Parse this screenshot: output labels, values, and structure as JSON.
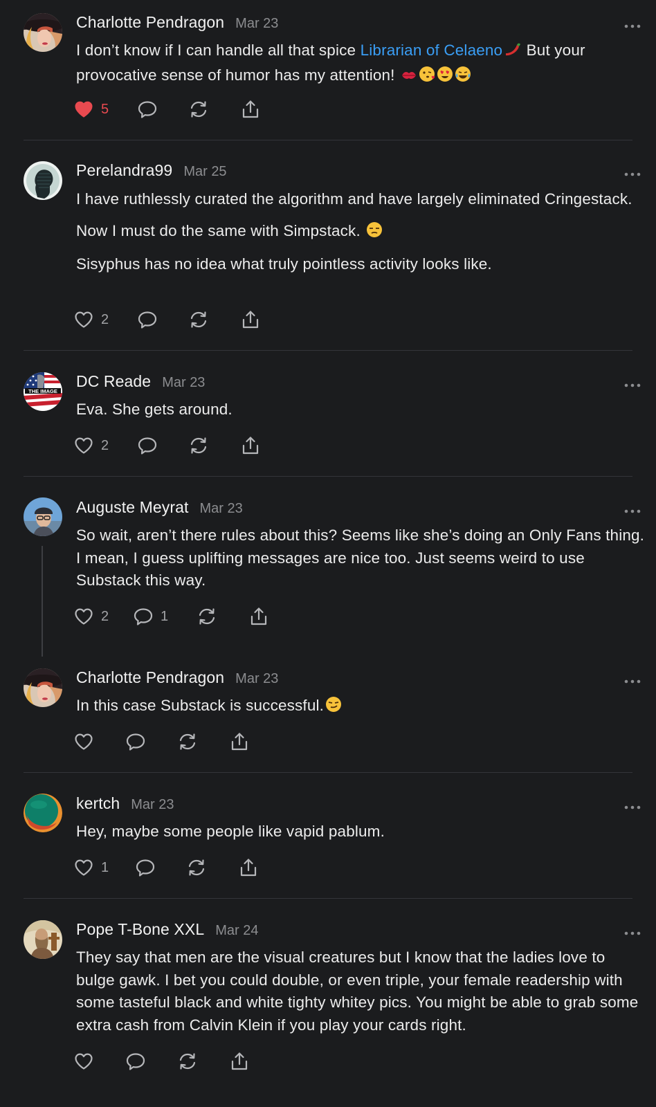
{
  "colors": {
    "background": "#1b1c1e",
    "link": "#3a9ef5",
    "liked_heart": "#e94a50",
    "muted": "#8c8d90"
  },
  "comments": [
    {
      "author": "Charlotte Pendragon",
      "date": "Mar 23",
      "text_before": "I don’t know if I can handle all that spice ",
      "mention": "Librarian of Celaeno",
      "text_after": " But your provocative sense of humor has my attention!",
      "emoji_icons": [
        "hot-pepper-icon",
        "kiss-mark-icon",
        "face-blowing-kiss-icon",
        "heart-eyes-icon",
        "tears-of-joy-icon"
      ],
      "likes": "5",
      "liked": true,
      "avatar_icon": "avatar-woman-hat-icon"
    },
    {
      "author": "Perelandra99",
      "date": "Mar 25",
      "paragraphs": [
        "I have ruthlessly curated the algorithm and have largely eliminated Cringestack.",
        "Now I must do the same with Simpstack.",
        "Sisyphus has no idea what truly pointless activity looks like."
      ],
      "emoji_icons": [
        "unamused-face-icon"
      ],
      "likes": "2",
      "avatar_icon": "avatar-silhouette-head-icon"
    },
    {
      "author": "DC Reade",
      "date": "Mar 23",
      "text": "Eva. She gets around.",
      "likes": "2",
      "avatar_icon": "avatar-the-image-flag-icon",
      "avatar_text": "THE IMAGE"
    },
    {
      "author": "Auguste Meyrat",
      "date": "Mar 23",
      "text": "So wait, aren’t there rules about this? Seems like she’s doing an Only Fans thing. I mean, I guess uplifting messages are nice too. Just seems weird to use Substack this way.",
      "likes": "2",
      "replies": "1",
      "avatar_icon": "avatar-man-glasses-cap-icon"
    },
    {
      "author": "Charlotte Pendragon",
      "date": "Mar 23",
      "text": "In this case Substack is successful.",
      "emoji_icons": [
        "smirking-face-icon"
      ],
      "avatar_icon": "avatar-woman-hat-icon"
    },
    {
      "author": "kertch",
      "date": "Mar 23",
      "text": "Hey, maybe some people like vapid pablum.",
      "likes": "1",
      "avatar_icon": "avatar-green-orange-circle-icon"
    },
    {
      "author": "Pope T-Bone XXL",
      "date": "Mar 24",
      "text": "They say that men are the visual creatures but I know that the ladies love to bulge gawk. I bet you could double, or even triple, your female readership with some tasteful black and white tighty whitey pics. You might be able to grab some extra cash from Calvin Klein if you play your cards right.",
      "avatar_icon": "avatar-bearded-pope-icon"
    }
  ]
}
